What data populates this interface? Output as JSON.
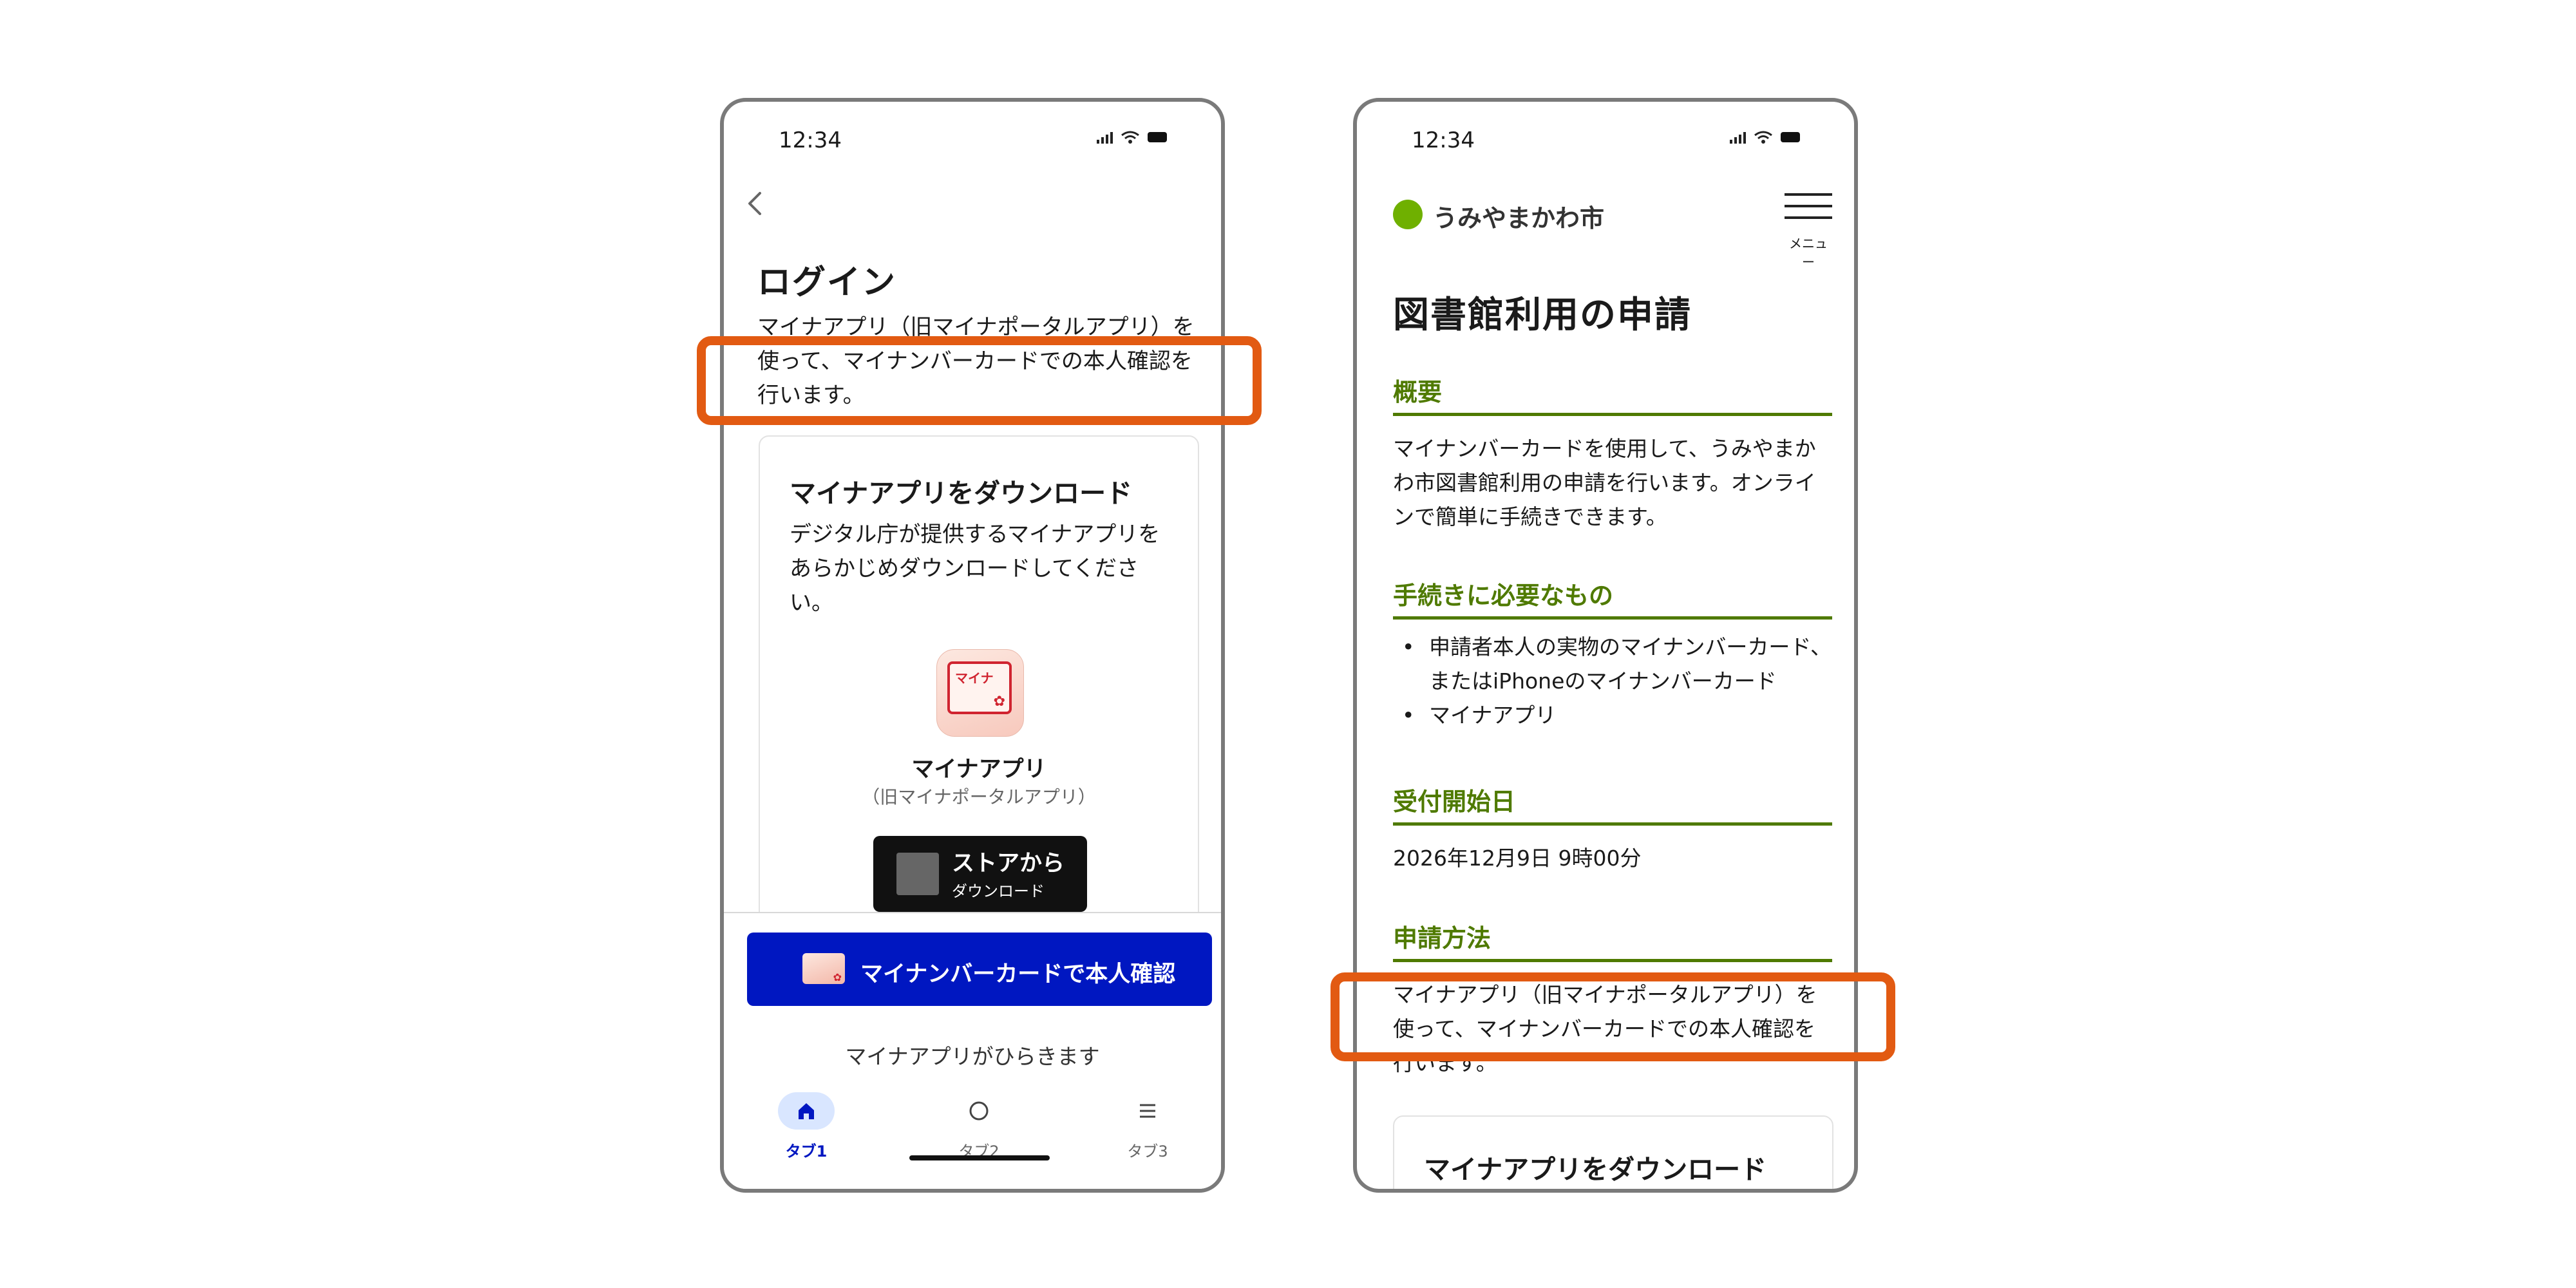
{
  "phone1": {
    "status": {
      "time": "12:34"
    },
    "title": "ログイン",
    "description": "マイナアプリ（旧マイナポータルアプリ）を使って、マイナンバーカードでの本人確認を行います。",
    "download_card": {
      "title": "マイナアプリをダウンロード",
      "description": "デジタル庁が提供するマイナアプリをあらかじめダウンロードしてください。",
      "app_icon_text": "マイナ",
      "app_name": "マイナアプリ",
      "app_subtitle": "（旧マイナポータルアプリ）",
      "store_button": {
        "line1": "ストアから",
        "line2": "ダウンロード"
      }
    },
    "primary_button": "マイナンバーカードで本人確認",
    "opens_note": "マイナアプリがひらきます",
    "tabs": [
      {
        "label": "タブ1",
        "icon": "home-icon",
        "active": true
      },
      {
        "label": "タブ2",
        "icon": "circle-icon",
        "active": false
      },
      {
        "label": "タブ3",
        "icon": "menu-icon",
        "active": false
      }
    ]
  },
  "phone2": {
    "status": {
      "time": "12:34"
    },
    "site_name": "うみやまかわ市",
    "menu_label": "メニュー",
    "title": "図書館利用の申請",
    "sections": {
      "overview": {
        "heading": "概要",
        "text": "マイナンバーカードを使用して、うみやまかわ市図書館利用の申請を行います。オンラインで簡単に手続きできます。"
      },
      "requirements": {
        "heading": "手続きに必要なもの",
        "items": [
          "申請者本人の実物のマイナンバーカード、またはiPhoneのマイナンバーカード",
          "マイナアプリ"
        ]
      },
      "start_date": {
        "heading": "受付開始日",
        "text": "2026年12月9日 9時00分"
      },
      "method": {
        "heading": "申請方法",
        "text": "マイナアプリ（旧マイナポータルアプリ）を使って、マイナンバーカードでの本人確認を行います。"
      }
    },
    "download_card_title": "マイナアプリをダウンロード"
  },
  "colors": {
    "highlight": "#e25a12",
    "primary_blue": "#0017c1",
    "city_green": "#4f7a00",
    "logo_green": "#6fb000"
  }
}
